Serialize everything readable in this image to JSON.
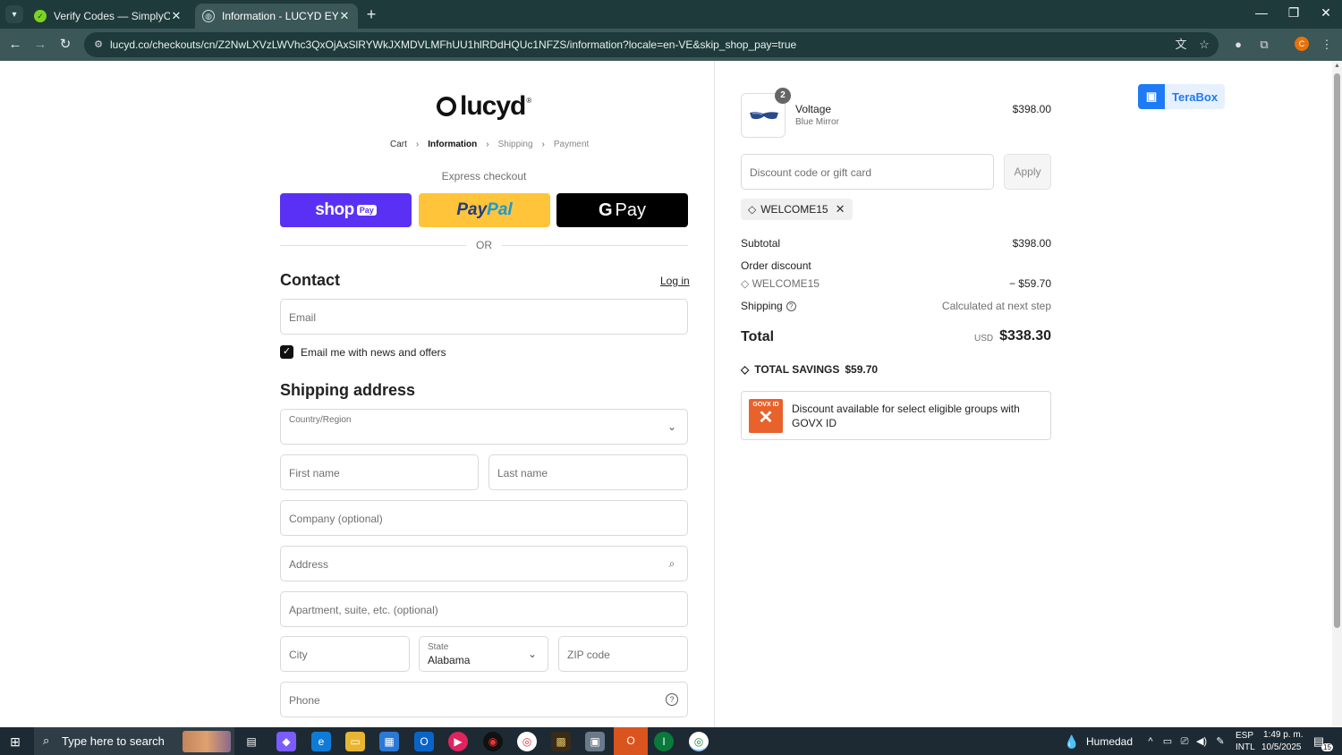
{
  "browser": {
    "tabs": [
      {
        "title": "Verify Codes — SimplyCodes",
        "favicon": "simplycodes-check-icon"
      },
      {
        "title": "Information - LUCYD EYEWEAR",
        "favicon": "globe-icon"
      }
    ],
    "url": "lucyd.co/checkouts/cn/Z2NwLXVzLWVhc3QxOjAxSlRYWkJXMDVLMFhUU1hlRDdHQUc1NFZS/information?locale=en-VE&skip_shop_pay=true"
  },
  "checkout": {
    "logo_text": "lucyd",
    "breadcrumb": [
      "Cart",
      "Information",
      "Shipping",
      "Payment"
    ],
    "express_label": "Express checkout",
    "shoppay_text": "shop",
    "shoppay_badge": "Pay",
    "paypal_a": "Pay",
    "paypal_b": "Pal",
    "gpay_text": "Pay",
    "or_text": "OR",
    "contact_title": "Contact",
    "login_link": "Log in",
    "email_placeholder": "Email",
    "newsletter_label": "Email me with news and offers",
    "newsletter_checked": true,
    "shipping_title": "Shipping address",
    "country_label": "Country/Region",
    "first_name_placeholder": "First name",
    "last_name_placeholder": "Last name",
    "company_placeholder": "Company (optional)",
    "address_placeholder": "Address",
    "apartment_placeholder": "Apartment, suite, etc. (optional)",
    "city_placeholder": "City",
    "state_label": "State",
    "state_value": "Alabama",
    "zip_placeholder": "ZIP code",
    "phone_placeholder": "Phone"
  },
  "summary": {
    "item": {
      "name": "Voltage",
      "variant": "Blue Mirror",
      "price": "$398.00",
      "quantity": "2"
    },
    "discount_placeholder": "Discount code or gift card",
    "apply_label": "Apply",
    "applied_code": "WELCOME15",
    "subtotal_label": "Subtotal",
    "subtotal_value": "$398.00",
    "order_discount_label": "Order discount",
    "discount_code": "WELCOME15",
    "discount_value": "− $59.70",
    "shipping_label": "Shipping",
    "shipping_value": "Calculated at next step",
    "total_label": "Total",
    "currency": "USD",
    "total_value": "$338.30",
    "savings_label": "TOTAL SAVINGS",
    "savings_value": "$59.70",
    "govx_logo_text": "GOVX ID",
    "govx_text": "Discount available for select eligible groups with GOVX ID"
  },
  "extension": {
    "terabox_label": "TeraBox"
  },
  "taskbar": {
    "search_placeholder": "Type here to search",
    "weather": "Humedad",
    "lang": "ESP",
    "layout": "INTL",
    "time": "1:49 p. m.",
    "date": "10/5/2025",
    "notifications": "15"
  },
  "colors": {
    "shoppay": "#5a31f4",
    "paypal": "#ffc439",
    "gpay": "#000000",
    "browser_frame": "#1f3a3a",
    "govx": "#e8622b",
    "terabox": "#1e7bf5"
  }
}
